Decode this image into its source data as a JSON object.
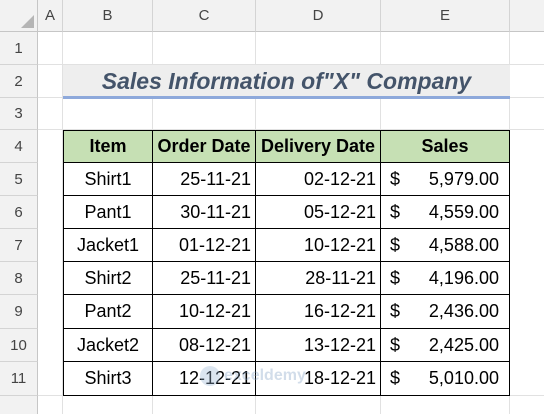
{
  "columns": [
    "A",
    "B",
    "C",
    "D",
    "E"
  ],
  "rows": [
    "1",
    "2",
    "3",
    "4",
    "5",
    "6",
    "7",
    "8",
    "9",
    "10",
    "11"
  ],
  "title": "Sales Information of\"X\" Company",
  "headers": [
    "Item",
    "Order Date",
    "Delivery Date",
    "Sales"
  ],
  "records": [
    {
      "item": "Shirt1",
      "order": "25-11-21",
      "delivery": "02-12-21",
      "cur": "$",
      "sales": "5,979.00"
    },
    {
      "item": "Pant1",
      "order": "30-11-21",
      "delivery": "05-12-21",
      "cur": "$",
      "sales": "4,559.00"
    },
    {
      "item": "Jacket1",
      "order": "01-12-21",
      "delivery": "10-12-21",
      "cur": "$",
      "sales": "4,588.00"
    },
    {
      "item": "Shirt2",
      "order": "25-11-21",
      "delivery": "28-11-21",
      "cur": "$",
      "sales": "4,196.00"
    },
    {
      "item": "Pant2",
      "order": "10-12-21",
      "delivery": "16-12-21",
      "cur": "$",
      "sales": "2,436.00"
    },
    {
      "item": "Jacket2",
      "order": "08-12-21",
      "delivery": "13-12-21",
      "cur": "$",
      "sales": "2,425.00"
    },
    {
      "item": "Shirt3",
      "order": "12-12-21",
      "delivery": "18-12-21",
      "cur": "$",
      "sales": "5,010.00"
    }
  ],
  "watermark": "exceldemy",
  "colors": {
    "header_fill": "#c6e0b4",
    "title_fill": "#eeeeee",
    "title_text": "#44546a",
    "title_underline": "#8ea9db"
  }
}
